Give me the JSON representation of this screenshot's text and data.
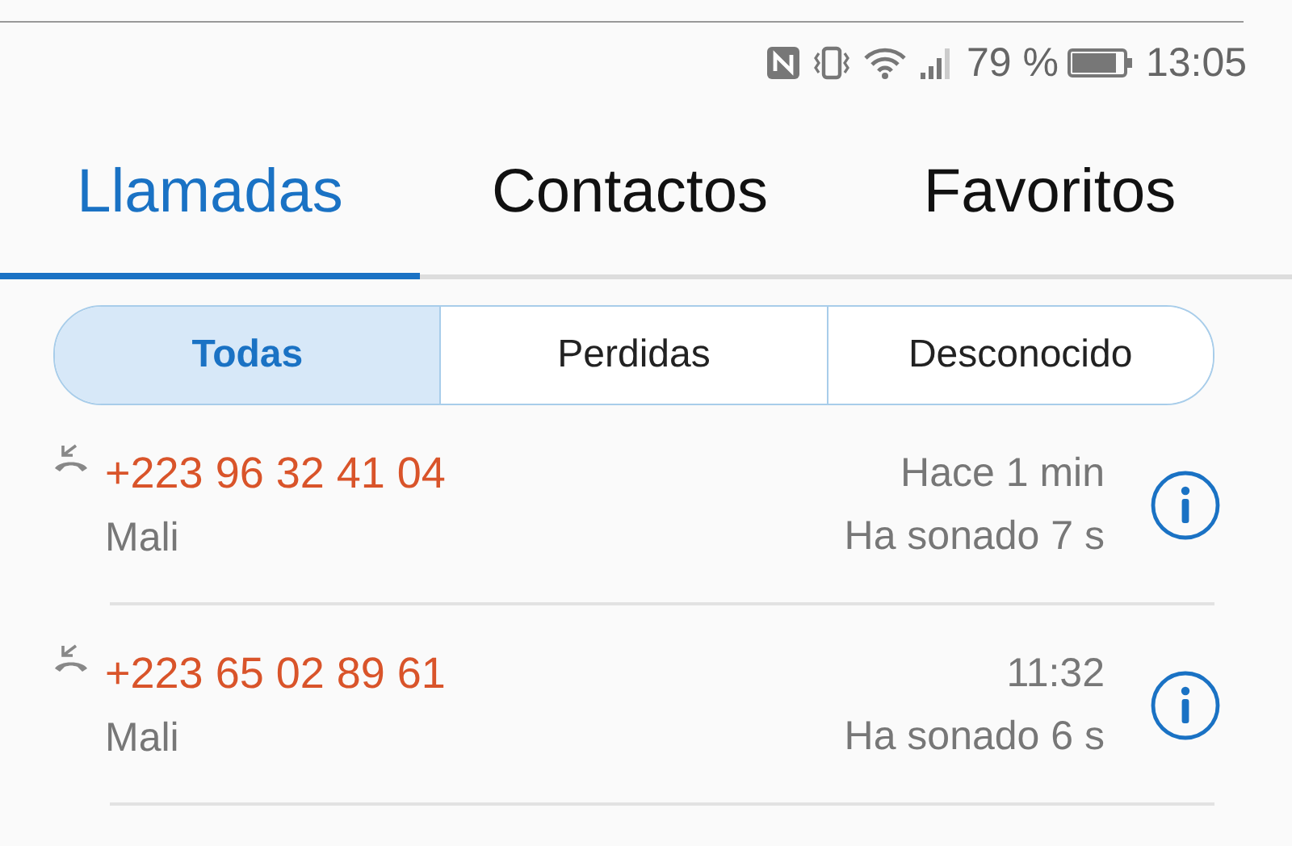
{
  "status_bar": {
    "battery_percent": "79 %",
    "time": "13:05"
  },
  "tabs": [
    {
      "label": "Llamadas",
      "selected": true
    },
    {
      "label": "Contactos",
      "selected": false
    },
    {
      "label": "Favoritos",
      "selected": false
    }
  ],
  "filters": [
    {
      "label": "Todas",
      "selected": true
    },
    {
      "label": "Perdidas",
      "selected": false
    },
    {
      "label": "Desconocido",
      "selected": false
    }
  ],
  "calls": [
    {
      "kind": "missed",
      "number": "+223 96 32 41 04",
      "location": "Mali",
      "time": "Hace 1 min",
      "duration": "Ha sonado 7 s"
    },
    {
      "kind": "missed",
      "number": "+223 65 02 89 61",
      "location": "Mali",
      "time": "11:32",
      "duration": "Ha sonado 6 s"
    }
  ]
}
